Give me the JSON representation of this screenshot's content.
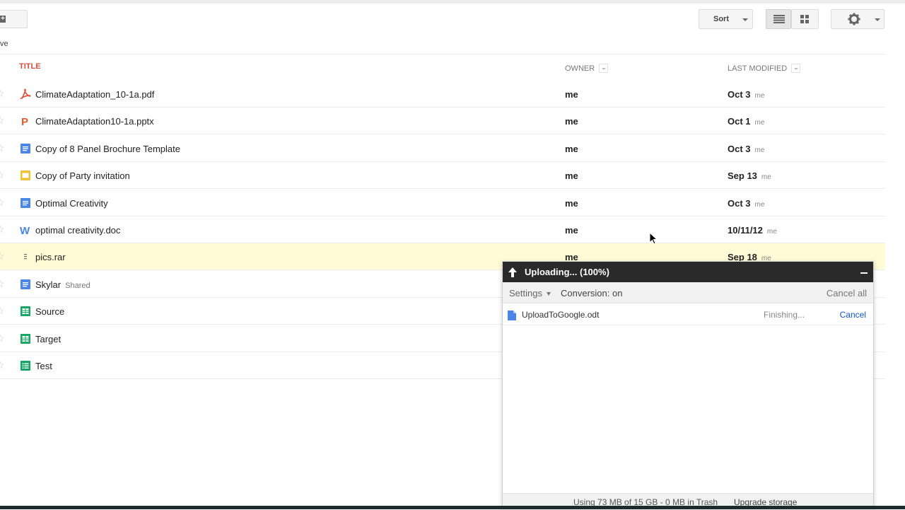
{
  "toolbar": {
    "new_icon": "plus-icon",
    "breadcrumb": "ve",
    "sort_label": "Sort",
    "list_view_icon": "list-view-icon",
    "grid_view_icon": "grid-view-icon",
    "settings_icon": "gear-icon"
  },
  "columns": {
    "title": "TITLE",
    "owner": "OWNER",
    "last_modified": "LAST MODIFIED"
  },
  "colors": {
    "title_header": "#dd4b39",
    "highlight_row": "#fffbd6",
    "link": "#1155cc",
    "doc": "#4a86e8",
    "sheet": "#16a765",
    "slides": "#f1c232",
    "pdf": "#dd4b39",
    "pptx": "#e55b2d"
  },
  "files": [
    {
      "name": "ClimateAdaptation_10-1a.pdf",
      "icon": "pdf-icon",
      "owner": "me",
      "modified": "Oct 3",
      "modified_by": "me"
    },
    {
      "name": "ClimateAdaptation10-1a.pptx",
      "icon": "powerpoint-icon",
      "owner": "me",
      "modified": "Oct 1",
      "modified_by": "me"
    },
    {
      "name": "Copy of 8 Panel Brochure Template",
      "icon": "document-icon",
      "owner": "me",
      "modified": "Oct 3",
      "modified_by": "me"
    },
    {
      "name": "Copy of Party invitation",
      "icon": "presentation-icon",
      "owner": "me",
      "modified": "Sep 13",
      "modified_by": "me"
    },
    {
      "name": "Optimal Creativity",
      "icon": "document-icon",
      "owner": "me",
      "modified": "Oct 3",
      "modified_by": "me"
    },
    {
      "name": "optimal creativity.doc",
      "icon": "word-icon",
      "owner": "me",
      "modified": "10/11/12",
      "modified_by": "me"
    },
    {
      "name": "pics.rar",
      "icon": "archive-icon",
      "owner": "me",
      "modified": "Sep 18",
      "modified_by": "me",
      "highlighted": true
    },
    {
      "name": "Skylar",
      "icon": "document-icon",
      "tag": "Shared",
      "owner": "",
      "modified": "",
      "modified_by": ""
    },
    {
      "name": "Source",
      "icon": "spreadsheet-icon",
      "owner": "",
      "modified": "",
      "modified_by": ""
    },
    {
      "name": "Target",
      "icon": "spreadsheet-icon",
      "owner": "",
      "modified": "",
      "modified_by": ""
    },
    {
      "name": "Test",
      "icon": "form-icon",
      "owner": "",
      "modified": "",
      "modified_by": ""
    }
  ],
  "upload": {
    "title": "Uploading... (100%)",
    "settings_label": "Settings",
    "conversion": "Conversion: on",
    "cancel_all": "Cancel all",
    "item": {
      "name": "UploadToGoogle.odt",
      "status": "Finishing...",
      "cancel": "Cancel"
    },
    "usage": "Using 73 MB of 15 GB - 0 MB in Trash",
    "upgrade": "Upgrade storage"
  }
}
